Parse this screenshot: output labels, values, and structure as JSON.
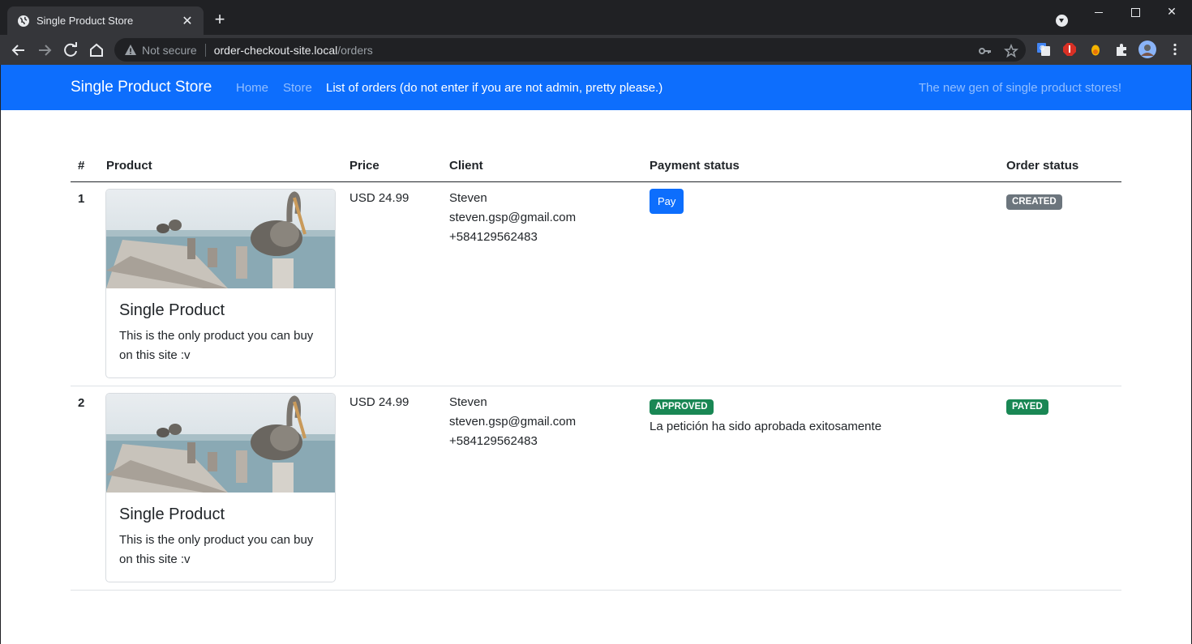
{
  "browser": {
    "tab_title": "Single Product Store",
    "not_secure": "Not secure",
    "url_host": "order-checkout-site.local",
    "url_path": "/orders"
  },
  "navbar": {
    "brand": "Single Product Store",
    "links": [
      {
        "label": "Home"
      },
      {
        "label": "Store"
      },
      {
        "label": "List of orders (do not enter if you are not admin, pretty please.)"
      }
    ],
    "tagline": "The new gen of single product stores!"
  },
  "table": {
    "headers": [
      "#",
      "Product",
      "Price",
      "Client",
      "Payment status",
      "Order status"
    ],
    "rows": [
      {
        "num": "1",
        "product_title": "Single Product",
        "product_desc": "This is the only product you can buy on this site :v",
        "price": "USD 24.99",
        "client_name": "Steven",
        "client_email": "steven.gsp@gmail.com",
        "client_phone": "+584129562483",
        "pay_button": "Pay",
        "order_status": "CREATED"
      },
      {
        "num": "2",
        "product_title": "Single Product",
        "product_desc": "This is the only product you can buy on this site :v",
        "price": "USD 24.99",
        "client_name": "Steven",
        "client_email": "steven.gsp@gmail.com",
        "client_phone": "+584129562483",
        "payment_status": "APPROVED",
        "payment_message": "La petición ha sido aprobada exitosamente",
        "order_status": "PAYED"
      }
    ]
  },
  "colors": {
    "primary": "#0d6efd",
    "badge_grey": "#6c757d",
    "badge_green": "#198754"
  }
}
